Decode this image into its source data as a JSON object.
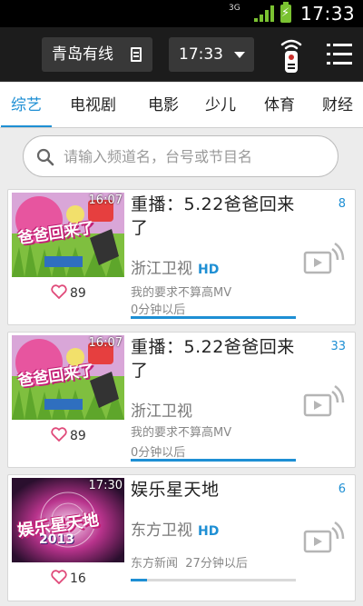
{
  "status_bar": {
    "network": "3G",
    "clock": "17:33"
  },
  "header": {
    "region": "青岛有线",
    "time": "17:33"
  },
  "tabs": [
    {
      "label": "综艺",
      "active": true
    },
    {
      "label": "电视剧",
      "active": false
    },
    {
      "label": "电影",
      "active": false
    },
    {
      "label": "少儿",
      "active": false
    },
    {
      "label": "体育",
      "active": false
    },
    {
      "label": "财经",
      "active": false
    }
  ],
  "search": {
    "placeholder": "请输入频道名，台号或节目名"
  },
  "programs": [
    {
      "thumb_time": "16:07",
      "thumb_text": "爸爸回来了",
      "title": "重播：5.22爸爸回来了",
      "channel": "浙江卫视",
      "hd": "HD",
      "program": "我的要求不算高MV",
      "time_info": "0分钟以后",
      "likes": "89",
      "count": "8",
      "progress": 1.0
    },
    {
      "thumb_time": "16:07",
      "thumb_text": "爸爸回来了",
      "title": "重播：5.22爸爸回来了",
      "channel": "浙江卫视",
      "hd": "",
      "program": "我的要求不算高MV",
      "time_info": "0分钟以后",
      "likes": "89",
      "count": "33",
      "progress": 1.0
    },
    {
      "thumb_time": "17:30",
      "thumb_text": "娱乐星天地",
      "thumb_year": "2013",
      "title": "娱乐星天地",
      "channel": "东方卫视",
      "hd": "HD",
      "program": "东方新闻",
      "time_info": "27分钟以后",
      "likes": "16",
      "count": "6",
      "progress": 0.1
    }
  ],
  "colors": {
    "accent": "#1e8fd4",
    "topbar": "#1c1c1c",
    "progress_track": "#d9d9d9"
  }
}
